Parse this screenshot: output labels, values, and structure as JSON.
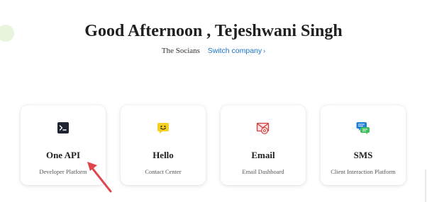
{
  "header": {
    "greeting": "Good Afternoon , Tejeshwani Singh",
    "company_name": "The Socians",
    "switch_company_label": "Switch company",
    "switch_chevron": "›"
  },
  "cards": [
    {
      "title": "One API",
      "subtitle": "Developer Platform",
      "icon": "terminal-icon"
    },
    {
      "title": "Hello",
      "subtitle": "Contact Center",
      "icon": "smiley-chat-icon"
    },
    {
      "title": "Email",
      "subtitle": "Email Dashboard",
      "icon": "envelope-at-icon"
    },
    {
      "title": "SMS",
      "subtitle": "Client Interaction Platform",
      "icon": "chat-bubbles-icon"
    }
  ],
  "colors": {
    "accent_link": "#1a73c9",
    "annotation_arrow": "#e0454b",
    "decor_blob": "#e8f5dc"
  }
}
